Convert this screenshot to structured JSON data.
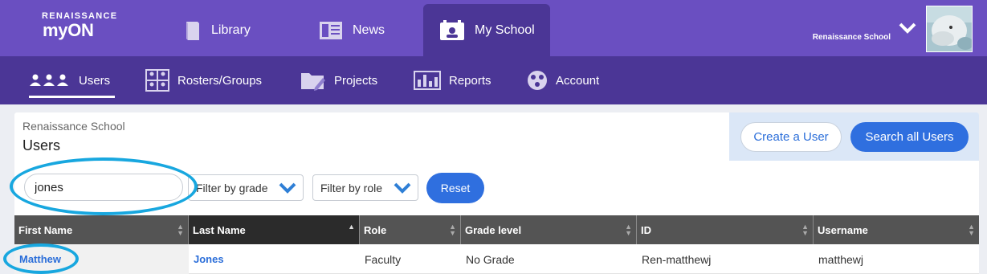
{
  "brand": {
    "small": "RENAISSANCE",
    "big": "myON"
  },
  "top_nav": [
    {
      "label": "Library",
      "icon": "book-icon"
    },
    {
      "label": "News",
      "icon": "newspaper-icon"
    },
    {
      "label": "My School",
      "icon": "school-icon",
      "active": true
    }
  ],
  "account_menu": {
    "school_name": "Renaissance School",
    "icon": "chevron-down-icon"
  },
  "sub_nav": [
    {
      "label": "Users",
      "icon": "users-icon",
      "active": true
    },
    {
      "label": "Rosters/Groups",
      "icon": "roster-icon"
    },
    {
      "label": "Projects",
      "icon": "folder-icon"
    },
    {
      "label": "Reports",
      "icon": "reports-icon"
    },
    {
      "label": "Account",
      "icon": "account-icon"
    }
  ],
  "page": {
    "breadcrumb": "Renaissance School",
    "title": "Users",
    "create_button": "Create a User",
    "search_all_button": "Search all Users"
  },
  "filters": {
    "search_value": "jones",
    "grade_label": "Filter by grade",
    "role_label": "Filter by role",
    "reset_label": "Reset"
  },
  "table": {
    "columns": [
      "First Name",
      "Last Name",
      "Role",
      "Grade level",
      "ID",
      "Username"
    ],
    "sorted_column": "Last Name",
    "rows": [
      {
        "first_name": "Matthew",
        "last_name": "Jones",
        "role": "Faculty",
        "grade": "No Grade",
        "id": "Ren-matthewj",
        "username": "matthewj"
      }
    ]
  },
  "colors": {
    "top_nav": "#6a4fc1",
    "sub_nav": "#4b3696",
    "accent_blue": "#2f6fdf",
    "highlight_ring": "#18a7df",
    "table_header": "#545454"
  }
}
